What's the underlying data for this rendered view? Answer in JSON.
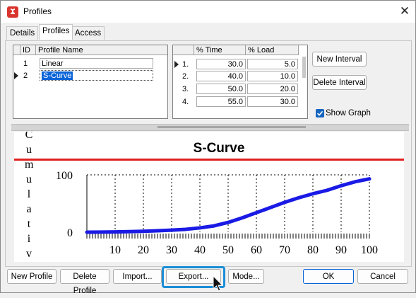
{
  "window": {
    "title": "Profiles",
    "close_glyph": "✕"
  },
  "tabs": [
    {
      "label": "Details",
      "active": false
    },
    {
      "label": "Profiles",
      "active": true
    },
    {
      "label": "Access",
      "active": false
    }
  ],
  "profiles_grid": {
    "headers": {
      "id": "ID",
      "name": "Profile Name"
    },
    "rows": [
      {
        "id": "1",
        "name": "Linear",
        "selected": false
      },
      {
        "id": "2",
        "name": "S-Curve",
        "selected": true
      }
    ]
  },
  "interval_grid": {
    "headers": {
      "time": "% Time",
      "load": "% Load"
    },
    "rows": [
      {
        "index": "1.",
        "time": "30.0",
        "load": "5.0"
      },
      {
        "index": "2.",
        "time": "40.0",
        "load": "10.0"
      },
      {
        "index": "3.",
        "time": "50.0",
        "load": "20.0"
      },
      {
        "index": "4.",
        "time": "55.0",
        "load": "30.0"
      }
    ]
  },
  "side_buttons": {
    "new_interval": "New Interval",
    "delete_interval": "Delete Interval"
  },
  "show_graph": {
    "label": "Show Graph",
    "checked": true
  },
  "bottom_buttons": {
    "new_profile": "New Profile",
    "delete_profile": "Delete Profile",
    "import": "Import...",
    "export": "Export...",
    "mode": "Mode...",
    "ok": "OK",
    "cancel": "Cancel"
  },
  "colors": {
    "accent": "#0a64d8",
    "title_line": "#e02020",
    "curve": "#1a1ae6",
    "app_icon": "#d8352f"
  },
  "chart_data": {
    "type": "line",
    "title": "S-Curve",
    "ylabel_visible_letters": [
      "C",
      "u",
      "m",
      "u",
      "l",
      "a",
      "t",
      "i",
      "v"
    ],
    "xlim": [
      0,
      100
    ],
    "ylim": [
      0,
      100
    ],
    "yticks": [
      "0",
      "100"
    ],
    "xticks": [
      "10",
      "20",
      "30",
      "40",
      "50",
      "60",
      "70",
      "80",
      "90",
      "100"
    ],
    "grid_vertical_dashed": true,
    "x": [
      0,
      5,
      10,
      15,
      20,
      25,
      30,
      35,
      40,
      45,
      50,
      55,
      60,
      65,
      70,
      75,
      80,
      85,
      90,
      95,
      100
    ],
    "y": [
      0,
      0.2,
      0.5,
      1,
      1.5,
      2.5,
      3.5,
      5,
      7.5,
      11,
      17,
      25,
      34,
      43,
      52,
      60,
      67,
      73,
      81,
      88,
      93
    ]
  }
}
